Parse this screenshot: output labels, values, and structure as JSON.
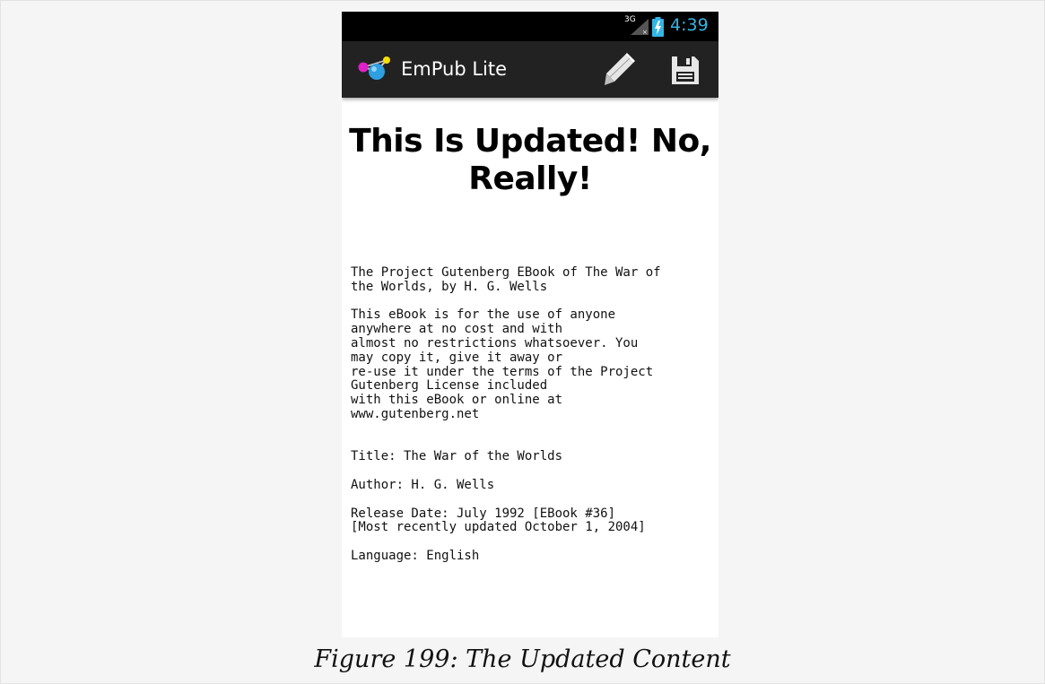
{
  "status_bar": {
    "network": "3G",
    "time": "4:39",
    "time_color": "#33b5e5"
  },
  "action_bar": {
    "app_title": "EmPub Lite",
    "icons": [
      "app-logo-icon",
      "pencil-icon",
      "floppy-disk-icon"
    ]
  },
  "content": {
    "headline": "This Is Updated! No, Really!",
    "body": "The Project Gutenberg EBook of The War of\nthe Worlds, by H. G. Wells\n\nThis eBook is for the use of anyone\nanywhere at no cost and with\nalmost no restrictions whatsoever. You\nmay copy it, give it away or\nre-use it under the terms of the Project\nGutenberg License included\nwith this eBook or online at\nwww.gutenberg.net\n\n\nTitle: The War of the Worlds\n\nAuthor: H. G. Wells\n\nRelease Date: July 1992 [EBook #36]\n[Most recently updated October 1, 2004]\n\nLanguage: English"
  },
  "caption": "Figure 199: The Updated Content"
}
